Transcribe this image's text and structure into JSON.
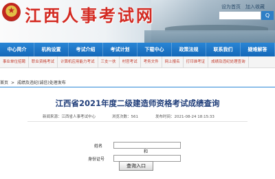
{
  "header": {
    "site_title": "江西人事考试网",
    "top_links": [
      "设为首页",
      "加入收藏"
    ],
    "search_button": "Q"
  },
  "nav": {
    "items": [
      "中心简介",
      "机构设置",
      "考试介绍",
      "考试计划",
      "下载中心",
      "政策法规",
      "联系我们",
      "疑难解答"
    ]
  },
  "subnav": {
    "items": [
      "事业单位招聘",
      "职业资格考试",
      "计算机应用能力考试",
      "三支一扶",
      "村官考试",
      "考务文件",
      "网上报名",
      "打印准考证",
      "成绩及违纪处理查询"
    ]
  },
  "breadcrumb": {
    "home": "首页",
    "sep": ">",
    "current": "成绩及违纪(诚信)处理发布"
  },
  "article": {
    "title": "江西省2021年度二级建造师资格考试成绩查询",
    "source": "新闻来源：江西省人事考试中心",
    "views": "浏览次数：561",
    "date": "发布时间：2021-08-24 18:15:33"
  },
  "form": {
    "name_label": "姓名",
    "and_text": "和",
    "id_label": "身份证号",
    "name_value": "",
    "id_value": "",
    "submit": "查询入口"
  }
}
